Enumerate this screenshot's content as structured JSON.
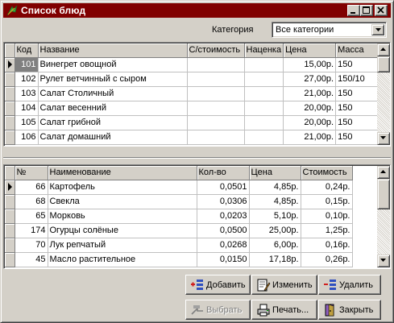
{
  "window": {
    "title": "Список блюд",
    "colors": {
      "titlebar": "#800000",
      "face": "#d4d0c8",
      "selection": "#808080"
    },
    "icons": {
      "app": "app-leaf-icon",
      "minimize": "minimize-icon",
      "maximize": "maximize-icon",
      "close": "close-icon"
    }
  },
  "filter": {
    "category_label": "Категория",
    "category_value": "Все категории"
  },
  "dishes": {
    "headers": [
      "Код",
      "Название",
      "С/стоимость",
      "Наценка",
      "Цена",
      "Масса"
    ],
    "rows": [
      {
        "code": "101",
        "name": "Винегрет овощной",
        "cost": "",
        "markup": "",
        "price": "15,00р.",
        "mass": "150"
      },
      {
        "code": "102",
        "name": "Рулет ветчинный с сыром",
        "cost": "",
        "markup": "",
        "price": "27,00р.",
        "mass": "150/10"
      },
      {
        "code": "103",
        "name": "Салат Столичный",
        "cost": "",
        "markup": "",
        "price": "21,00р.",
        "mass": "150"
      },
      {
        "code": "104",
        "name": "Салат весенний",
        "cost": "",
        "markup": "",
        "price": "20,00р.",
        "mass": "150"
      },
      {
        "code": "105",
        "name": "Салат грибной",
        "cost": "",
        "markup": "",
        "price": "20,00р.",
        "mass": "150"
      },
      {
        "code": "106",
        "name": "Салат домашний",
        "cost": "",
        "markup": "",
        "price": "21,00р.",
        "mass": "150"
      }
    ]
  },
  "ingredients": {
    "headers": [
      "№",
      "Наименование",
      "Кол-во",
      "Цена",
      "Стоимость"
    ],
    "rows": [
      {
        "num": "66",
        "name": "Картофель",
        "qty": "0,0501",
        "price": "4,85р.",
        "cost": "0,24р."
      },
      {
        "num": "68",
        "name": "Свекла",
        "qty": "0,0306",
        "price": "4,85р.",
        "cost": "0,15р."
      },
      {
        "num": "65",
        "name": "Морковь",
        "qty": "0,0203",
        "price": "5,10р.",
        "cost": "0,10р."
      },
      {
        "num": "174",
        "name": "Огурцы солёные",
        "qty": "0,0500",
        "price": "25,00р.",
        "cost": "1,25р."
      },
      {
        "num": "70",
        "name": "Лук репчатый",
        "qty": "0,0268",
        "price": "6,00р.",
        "cost": "0,16р."
      },
      {
        "num": "45",
        "name": "Масло растительное",
        "qty": "0,0150",
        "price": "17,18р.",
        "cost": "0,26р."
      }
    ]
  },
  "buttons": {
    "add": "Добавить",
    "edit": "Изменить",
    "delete": "Удалить",
    "choose": "Выбрать",
    "print": "Печать...",
    "close": "Закрыть"
  }
}
